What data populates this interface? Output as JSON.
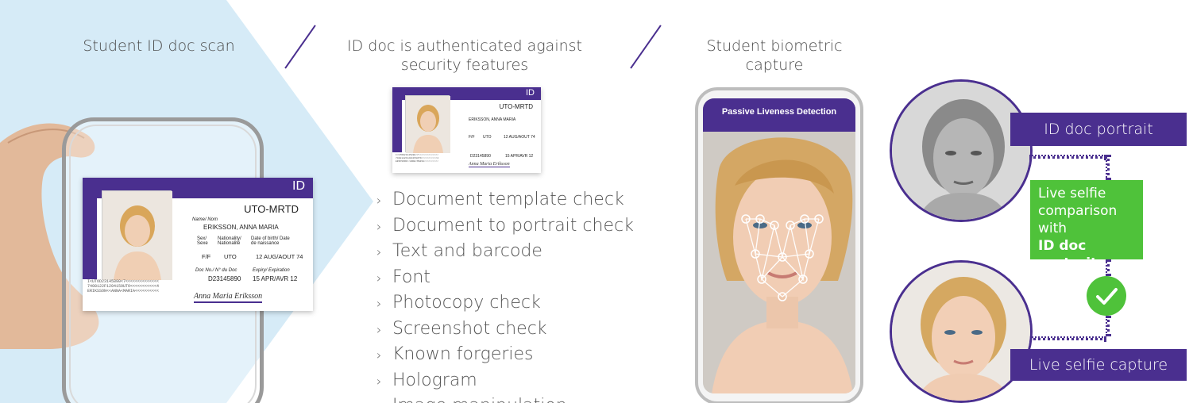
{
  "colors": {
    "purple": "#4a2f8f",
    "green": "#4fc23a",
    "light_blue": "#d6ebf7"
  },
  "steps": {
    "scan_title": "Student ID doc scan",
    "auth_title_line1": "ID doc is authenticated against",
    "auth_title_line2": "security features",
    "bio_title_line1": "Student biometric",
    "bio_title_line2": "capture"
  },
  "id_card": {
    "badge": "ID",
    "doc_type": "UTO-MRTD",
    "name_label": "Name/ Nom",
    "name": "ERIKSSON, ANNA MARIA",
    "sex_label": "Sex/ Sexe",
    "nationality_label": "Nationality/ Nationalité",
    "dob_label": "Date of birth/ Date de naissance",
    "sex": "F/F",
    "nationality": "UTO",
    "dob": "12 AUG/AOUT 74",
    "docno_label": "Doc No./ N° du Doc",
    "docno": "D23145890",
    "expiry_label": "Expiry/ Expiration",
    "expiry": "15 APR/AVR 12",
    "mrz1": "I<UTOD23145890<7<<<<<<<<<<<<<<",
    "mrz2": "7408122F1204159UTO<<<<<<<<<<<4",
    "mrz3": "ERIKSSON<<ANNA<MARIA<<<<<<<<<<",
    "signature": "Anna Maria Eriksson"
  },
  "checks": [
    "Document template check",
    "Document to portrait check",
    "Text and barcode",
    "Font",
    "Photocopy check",
    "Screenshot check",
    "Known forgeries",
    "Hologram",
    "Image manipulation"
  ],
  "liveness": {
    "bar_label": "Passive Liveness Detection"
  },
  "comparison": {
    "id_portrait_label": "ID doc portrait",
    "live_capture_label": "Live selfie capture",
    "green_text": "Live selfie comparison with",
    "green_bold": "ID doc portrait"
  },
  "icons": {
    "bullet": "chevron-right-icon",
    "verified": "check-icon"
  }
}
